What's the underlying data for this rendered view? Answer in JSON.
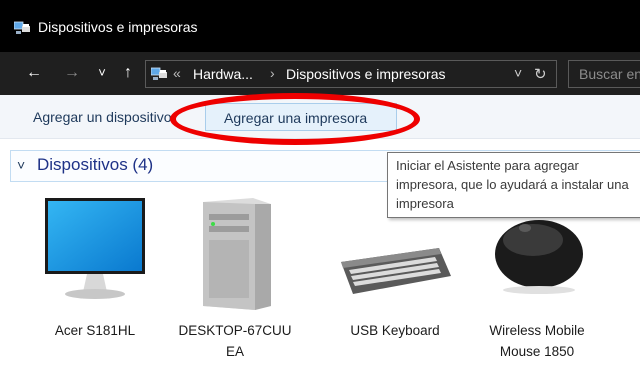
{
  "window": {
    "title": "Dispositivos e impresoras",
    "icon": "devices-and-printers-icon"
  },
  "nav": {
    "back": "←",
    "forward": "→",
    "recent": "˅",
    "up": "↑",
    "breadcrumb_overflow": "«",
    "crumbs": [
      "Hardwa...",
      "Dispositivos e impresoras"
    ],
    "crumb_separator": "›",
    "dropdown": "˅",
    "refresh": "↻",
    "search_placeholder": "Buscar en"
  },
  "commands": {
    "add_device": "Agregar un dispositivo",
    "add_printer": "Agregar una impresora"
  },
  "tooltip": {
    "text": "Iniciar el Asistente para agregar impresora, que lo ayudará a instalar una impresora"
  },
  "group": {
    "toggle": "˅",
    "title": "Dispositivos (4)"
  },
  "devices": [
    {
      "line1": "Acer S181HL",
      "line2": "",
      "icon": "monitor-icon"
    },
    {
      "line1": "DESKTOP-67CUU",
      "line2": "EA",
      "icon": "computer-tower-icon"
    },
    {
      "line1": "USB Keyboard",
      "line2": "",
      "icon": "keyboard-icon"
    },
    {
      "line1": "Wireless Mobile",
      "line2": "Mouse 1850",
      "icon": "mouse-icon"
    }
  ],
  "colors": {
    "highlight_ring": "#ee0000",
    "titlebar": "#000000",
    "command_bar": "#f3f6fa",
    "group_title": "#1e3287"
  }
}
